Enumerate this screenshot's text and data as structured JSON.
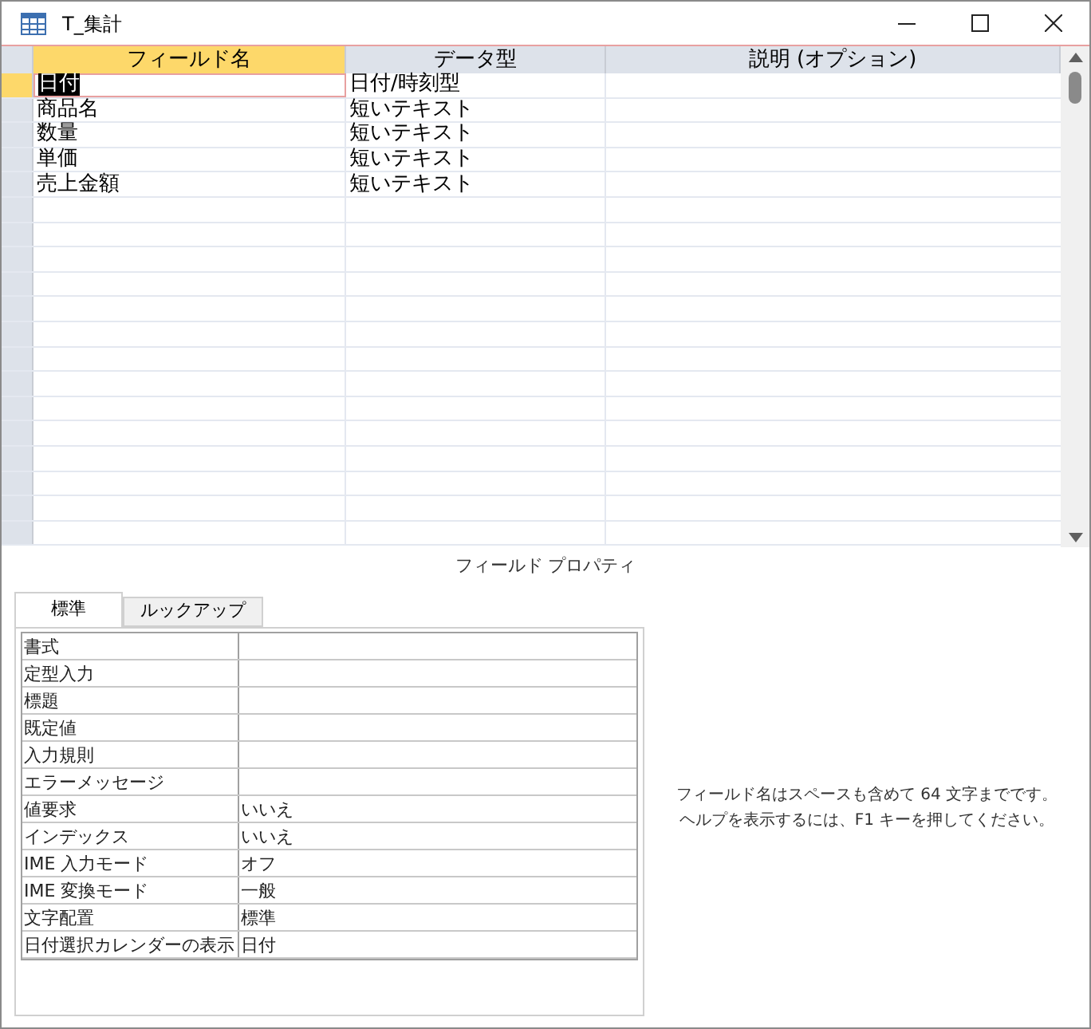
{
  "window": {
    "title": "T_集計"
  },
  "table": {
    "columns": [
      "フィールド名",
      "データ型",
      "説明 (オプション)"
    ],
    "rows": [
      {
        "name": "日付",
        "type": "日付/時刻型",
        "selected": true
      },
      {
        "name": "商品名",
        "type": "短いテキスト",
        "selected": false
      },
      {
        "name": "数量",
        "type": "短いテキスト",
        "selected": false
      },
      {
        "name": "単価",
        "type": "短いテキスト",
        "selected": false
      },
      {
        "name": "売上金額",
        "type": "短いテキスト",
        "selected": false
      }
    ]
  },
  "properties_label": "フィールド プロパティ",
  "tabs": [
    {
      "label": "標準",
      "selected": true
    },
    {
      "label": "ルックアップ",
      "selected": false
    }
  ],
  "properties": [
    {
      "label": "書式"
    },
    {
      "label": "定型入力"
    },
    {
      "label": "標題"
    },
    {
      "label": "既定値"
    },
    {
      "label": "入力規則"
    },
    {
      "label": "エラーメッセージ"
    },
    {
      "label": "値要求",
      "value": "いいえ"
    },
    {
      "label": "インデックス",
      "value": "いいえ"
    },
    {
      "label": "IME 入力モード",
      "value": "オフ"
    },
    {
      "label": "IME 変換モード",
      "value": "一般"
    },
    {
      "label": "文字配置",
      "value": "標準"
    },
    {
      "label": "日付選択カレンダーの表示",
      "value": "日付"
    }
  ],
  "help_text": [
    "フィールド名はスペースも含めて 64 文字までです。",
    "ヘルプを表示するには、F1 キーを押してください。"
  ]
}
